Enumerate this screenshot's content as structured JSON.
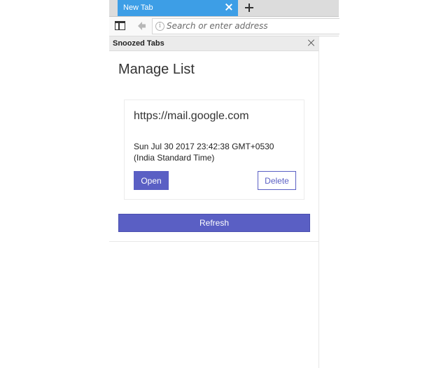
{
  "tab": {
    "title": "New Tab"
  },
  "urlbar": {
    "placeholder": "Search or enter address"
  },
  "sidebar": {
    "title": "Snoozed Tabs",
    "heading": "Manage List",
    "items": [
      {
        "url": "https://mail.google.com",
        "time": "Sun Jul 30 2017 23:42:38 GMT+0530 (India Standard Time)",
        "open_label": "Open",
        "delete_label": "Delete"
      }
    ],
    "refresh_label": "Refresh"
  },
  "colors": {
    "tab_active": "#3d9ee6",
    "accent": "#5a5fc4"
  }
}
